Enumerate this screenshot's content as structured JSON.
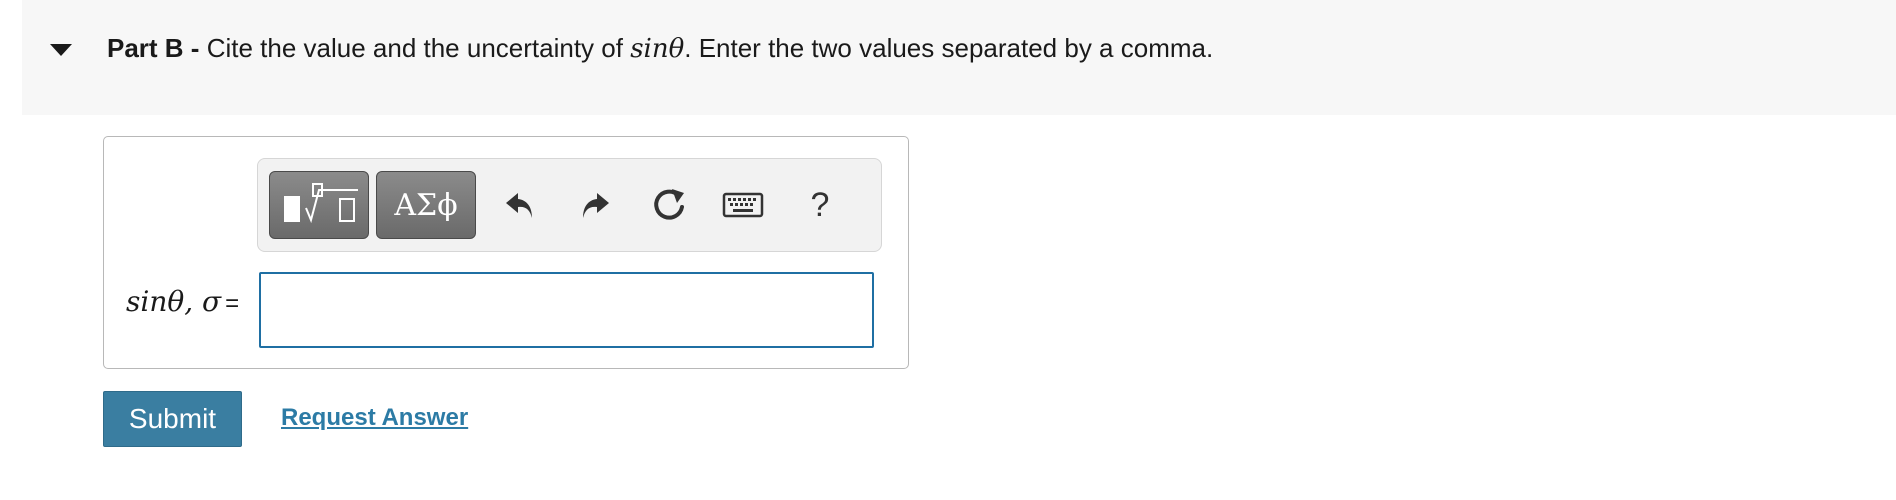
{
  "part": {
    "label": "Part B -",
    "prompt_before": " Cite the value and the uncertainty of ",
    "prompt_math": "sinθ",
    "prompt_after": ". Enter the two values separated by a comma."
  },
  "toolbar": {
    "templates_icon": "templates-radical-icon",
    "symbols_label": "ΑΣϕ",
    "undo_icon": "undo-icon",
    "redo_icon": "redo-icon",
    "reset_icon": "reset-icon",
    "keyboard_icon": "keyboard-icon",
    "help_label": "?"
  },
  "answer": {
    "label_math": "sinθ, σ",
    "label_equals": "=",
    "value": ""
  },
  "actions": {
    "submit_label": "Submit",
    "request_answer_label": "Request Answer"
  },
  "colors": {
    "header_background": "#f7f7f7",
    "input_border": "#1f6fa3",
    "submit_background": "#3a7ea1",
    "link": "#2c7ba5"
  }
}
